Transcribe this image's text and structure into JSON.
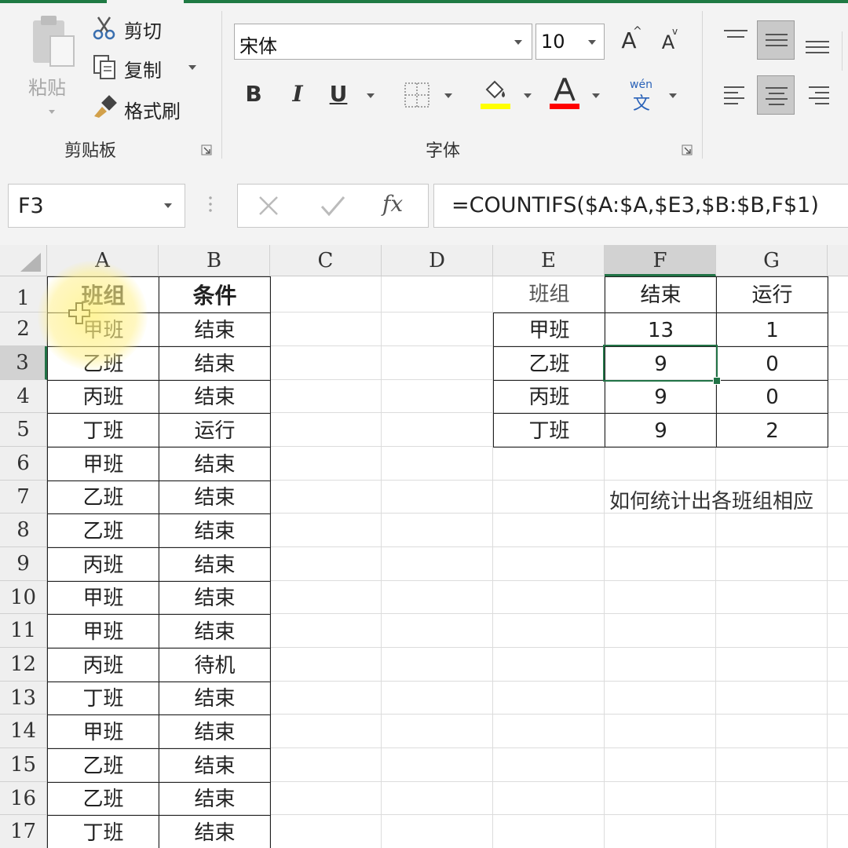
{
  "clipboard": {
    "paste_label": "粘贴",
    "cut_label": "剪切",
    "copy_label": "复制",
    "format_painter_label": "格式刷",
    "group_label": "剪贴板"
  },
  "font": {
    "font_name": "宋体",
    "font_size": "10",
    "bold": "B",
    "italic": "I",
    "underline": "U",
    "grow_font": "A",
    "shrink_font": "A",
    "phonetic_top": "wén",
    "phonetic_bottom": "文",
    "group_label": "字体",
    "fill_color": "#ffff00",
    "font_color": "#ff0000"
  },
  "formula_bar": {
    "name_box": "F3",
    "fx": "fx",
    "formula": "=COUNTIFS($A:$A,$E3,$B:$B,F$1)"
  },
  "sheet": {
    "columns": [
      "A",
      "B",
      "C",
      "D",
      "E",
      "F",
      "G"
    ],
    "rows": [
      "1",
      "2",
      "3",
      "4",
      "5",
      "6",
      "7",
      "8",
      "9",
      "10",
      "11",
      "12",
      "13",
      "14",
      "15",
      "16",
      "17"
    ],
    "source_headers": [
      "班组",
      "条件"
    ],
    "source_rows": [
      [
        "甲班",
        "结束"
      ],
      [
        "乙班",
        "结束"
      ],
      [
        "丙班",
        "结束"
      ],
      [
        "丁班",
        "运行"
      ],
      [
        "甲班",
        "结束"
      ],
      [
        "乙班",
        "结束"
      ],
      [
        "乙班",
        "结束"
      ],
      [
        "丙班",
        "结束"
      ],
      [
        "甲班",
        "结束"
      ],
      [
        "甲班",
        "结束"
      ],
      [
        "丙班",
        "待机"
      ],
      [
        "丁班",
        "结束"
      ],
      [
        "甲班",
        "结束"
      ],
      [
        "乙班",
        "结束"
      ],
      [
        "乙班",
        "结束"
      ],
      [
        "丁班",
        "结束"
      ]
    ],
    "summary_headers": [
      "班组",
      "结束",
      "运行"
    ],
    "summary_rows": [
      [
        "甲班",
        "13",
        "1"
      ],
      [
        "乙班",
        "9",
        "0"
      ],
      [
        "丙班",
        "9",
        "0"
      ],
      [
        "丁班",
        "9",
        "2"
      ]
    ],
    "note": "如何统计出各班组相应"
  }
}
